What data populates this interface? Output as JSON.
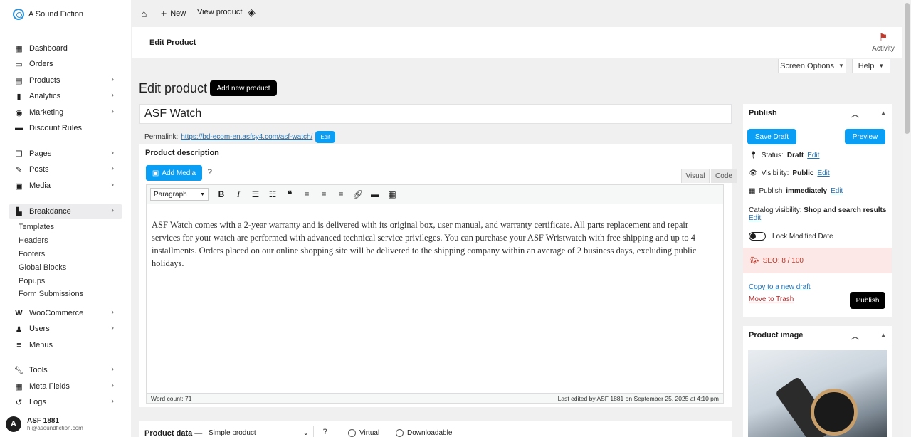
{
  "site": {
    "name": "A Sound Fiction"
  },
  "sidebar": {
    "items": [
      {
        "label": "Dashboard",
        "icon": "dashboard-icon"
      },
      {
        "label": "Orders",
        "icon": "orders-icon"
      },
      {
        "label": "Products",
        "icon": "products-icon"
      },
      {
        "label": "Analytics",
        "icon": "analytics-icon"
      },
      {
        "label": "Marketing",
        "icon": "marketing-icon"
      },
      {
        "label": "Discount Rules",
        "icon": "discount-icon"
      },
      {
        "label": "Pages",
        "icon": "pages-icon"
      },
      {
        "label": "Posts",
        "icon": "posts-icon"
      },
      {
        "label": "Media",
        "icon": "media-icon"
      },
      {
        "label": "Breakdance",
        "icon": "breakdance-icon"
      },
      {
        "label": "WooCommerce",
        "icon": "woocommerce-icon"
      },
      {
        "label": "Users",
        "icon": "users-icon"
      },
      {
        "label": "Menus",
        "icon": "menus-icon"
      },
      {
        "label": "Tools",
        "icon": "tools-icon"
      },
      {
        "label": "Meta Fields",
        "icon": "meta-fields-icon"
      },
      {
        "label": "Logs",
        "icon": "logs-icon"
      }
    ],
    "breakdance_sub": [
      "Templates",
      "Headers",
      "Footers",
      "Global Blocks",
      "Popups",
      "Form Submissions"
    ]
  },
  "user": {
    "initial": "A",
    "name": "ASF 1881",
    "email": "hi@asoundfiction.com"
  },
  "topbar": {
    "new_label": "New",
    "view_label": "View product"
  },
  "header": {
    "title": "Edit Product",
    "activity_label": "Activity",
    "screen_options": "Screen Options",
    "help": "Help"
  },
  "page": {
    "title": "Edit product",
    "add_new": "Add new product"
  },
  "product": {
    "name": "ASF Watch",
    "permalink_label": "Permalink:",
    "permalink_url": "https://bd-ecom-en.asfsy4.com/asf-watch/",
    "edit_label": "Edit"
  },
  "description": {
    "label": "Product description",
    "add_media": "Add Media",
    "tab_visual": "Visual",
    "tab_code": "Code",
    "format": "Paragraph",
    "content": "ASF Watch comes with a 2-year warranty and is delivered with its original box, user manual, and warranty certificate. All parts replacement and repair services for your watch are performed with advanced technical service privileges. You can purchase your ASF Wristwatch with free shipping and up to 4 installments. Orders placed on our online shopping site will be delivered to the shipping company within an average of 2 business days, excluding public holidays.",
    "word_count": "Word count: 71",
    "last_edited": "Last edited by ASF 1881 on September 25, 2025 at 4:10 pm"
  },
  "product_data": {
    "label": "Product data —",
    "type": "Simple product",
    "virtual": "Virtual",
    "downloadable": "Downloadable"
  },
  "publish": {
    "title": "Publish",
    "save_draft": "Save Draft",
    "preview": "Preview",
    "status_label": "Status:",
    "status_value": "Draft",
    "visibility_label": "Visibility:",
    "visibility_value": "Public",
    "publish_label": "Publish",
    "publish_value": "immediately",
    "edit": "Edit",
    "catalog_label": "Catalog visibility:",
    "catalog_value": "Shop and search results",
    "lock_label": "Lock Modified Date",
    "seo": "SEO: 8 / 100",
    "copy_draft": "Copy to a new draft",
    "trash": "Move to Trash",
    "publish_btn": "Publish"
  },
  "product_image": {
    "title": "Product image"
  }
}
